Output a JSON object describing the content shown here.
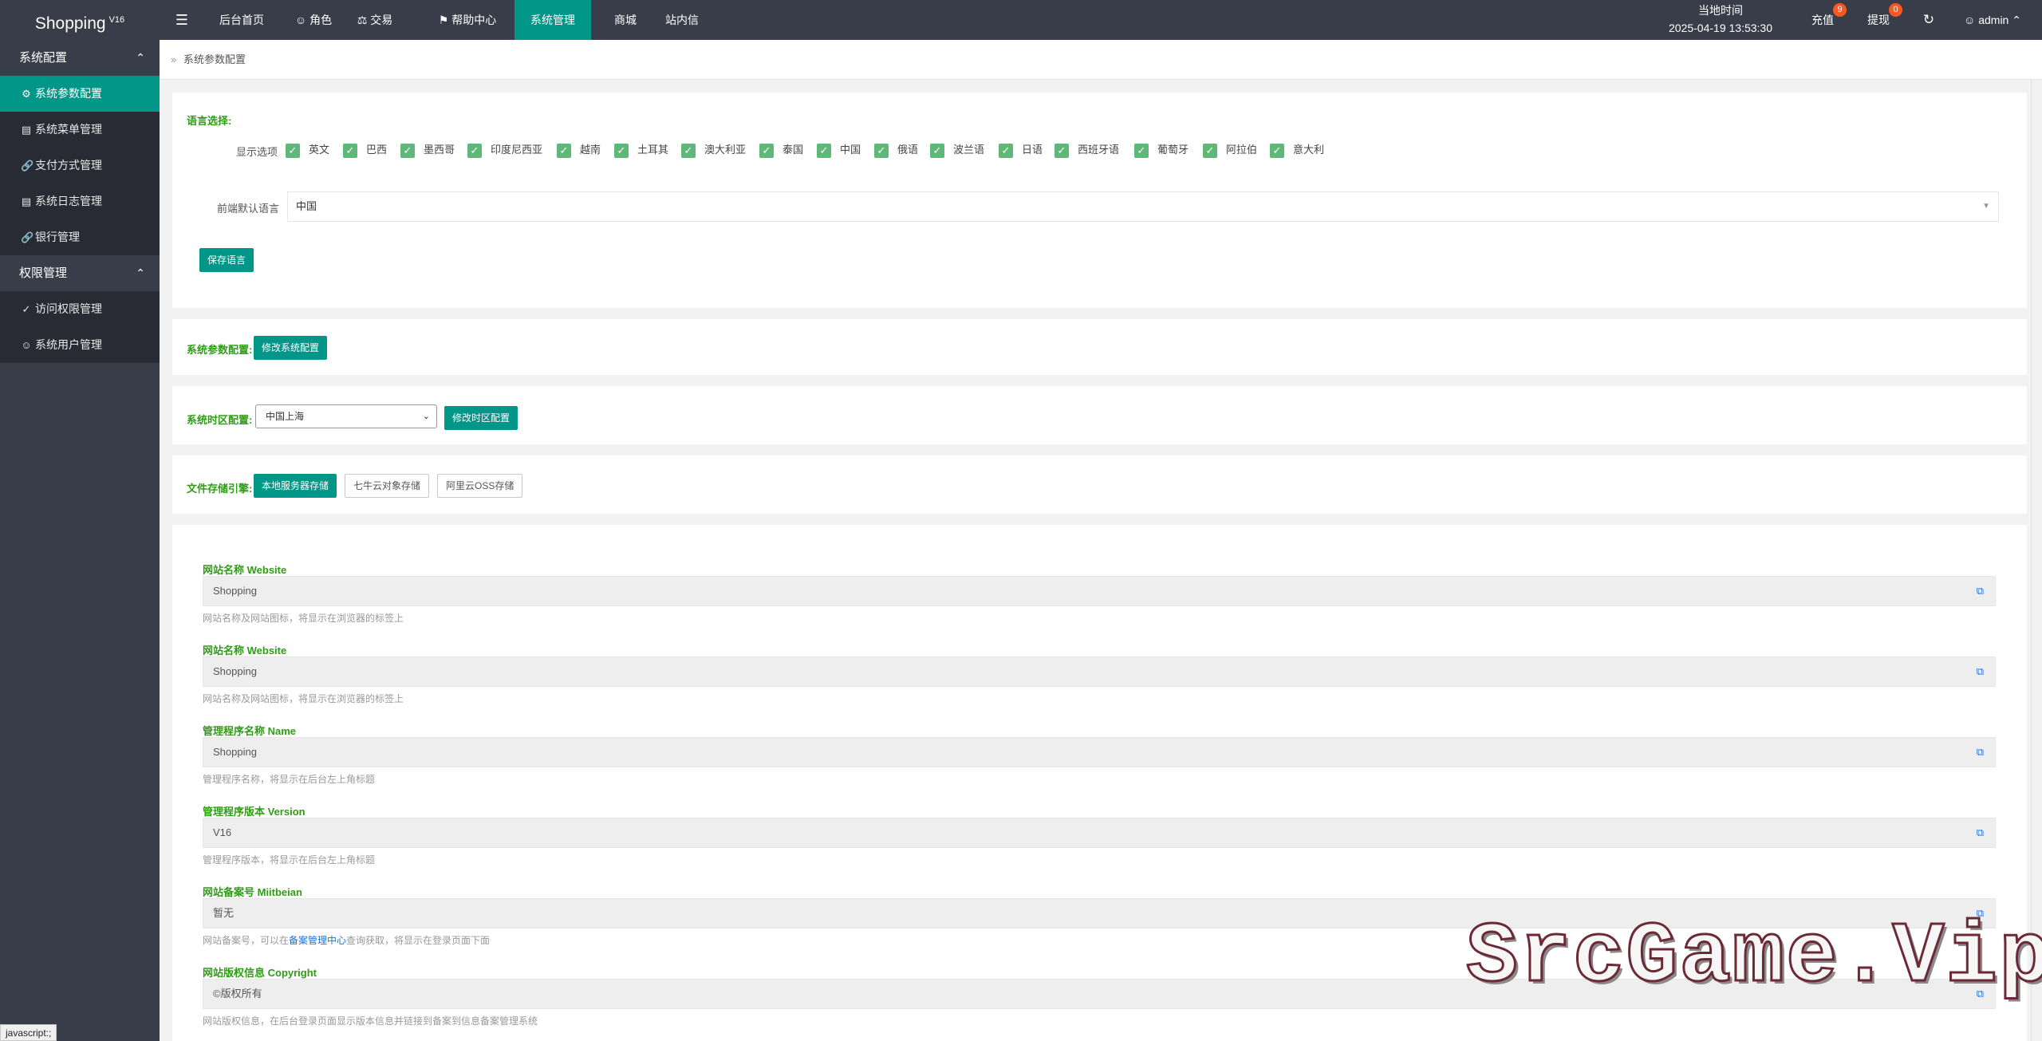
{
  "app": {
    "name": "Shopping",
    "version": "V16"
  },
  "sidebar": {
    "groups": [
      {
        "label": "系统配置",
        "items": [
          {
            "label": "系统参数配置",
            "icon": "gear-icon",
            "active": true
          },
          {
            "label": "系统菜单管理",
            "icon": "window-icon"
          },
          {
            "label": "支付方式管理",
            "icon": "link-icon"
          },
          {
            "label": "系统日志管理",
            "icon": "file-icon"
          },
          {
            "label": "银行管理",
            "icon": "link-icon"
          }
        ]
      },
      {
        "label": "权限管理",
        "items": [
          {
            "label": "访问权限管理",
            "icon": "shield-check-icon"
          },
          {
            "label": "系统用户管理",
            "icon": "user-icon"
          }
        ]
      }
    ]
  },
  "header": {
    "menu_icon": "menu-icon",
    "nav": [
      {
        "label": "后台首页"
      },
      {
        "label": "角色",
        "icon": "user-icon"
      },
      {
        "label": "交易",
        "icon": "scale-icon"
      },
      {
        "label": "帮助中心",
        "icon": "flag-icon"
      },
      {
        "label": "系统管理",
        "active": true
      },
      {
        "label": "商城"
      },
      {
        "label": "站内信"
      }
    ],
    "time_label": "当地时间",
    "time_value": "2025-04-19 13:53:30",
    "recharge": {
      "label": "充值",
      "count": "9"
    },
    "withdraw": {
      "label": "提现",
      "count": "0"
    },
    "refresh_icon": "refresh-icon",
    "user": "admin"
  },
  "breadcrumb": {
    "text": "系统参数配置"
  },
  "language": {
    "title": "语言选择:",
    "display_label": "显示选项",
    "options": [
      "英文",
      "巴西",
      "墨西哥",
      "印度尼西亚",
      "越南",
      "土耳其",
      "澳大利亚",
      "泰国",
      "中国",
      "俄语",
      "波兰语",
      "日语",
      "西班牙语",
      "葡萄牙",
      "阿拉伯",
      "意大利"
    ],
    "default_label": "前端默认语言",
    "default_value": "中国",
    "save_button": "保存语言"
  },
  "system_params": {
    "label": "系统参数配置:",
    "button": "修改系统配置"
  },
  "timezone": {
    "label": "系统时区配置:",
    "value": "中国上海",
    "button": "修改时区配置"
  },
  "storage": {
    "label": "文件存储引擎:",
    "options": [
      "本地服务器存储",
      "七牛云对象存储",
      "阿里云OSS存储"
    ],
    "selected": "本地服务器存储"
  },
  "fields": [
    {
      "title": "网站名称 Website",
      "value": "Shopping",
      "hint": "网站名称及网站图标，将显示在浏览器的标签上"
    },
    {
      "title": "网站名称 Website",
      "value": "Shopping",
      "hint": "网站名称及网站图标，将显示在浏览器的标签上"
    },
    {
      "title": "管理程序名称 Name",
      "value": "Shopping",
      "hint": "管理程序名称，将显示在后台左上角标题"
    },
    {
      "title": "管理程序版本 Version",
      "value": "V16",
      "hint": "管理程序版本，将显示在后台左上角标题"
    },
    {
      "title": "网站备案号 Miitbeian",
      "value": "暂无",
      "hint_pre": "网站备案号，可以在",
      "hint_link": "备案管理中心",
      "hint_post": "查询获取，将显示在登录页面下面"
    },
    {
      "title": "网站版权信息 Copyright",
      "value": "©版权所有",
      "hint": "网站版权信息，在后台登录页面显示版本信息并链接到备案到信息备案管理系统"
    }
  ],
  "watermark": "SrcGame.Vip",
  "status_bar": "javascript:;"
}
